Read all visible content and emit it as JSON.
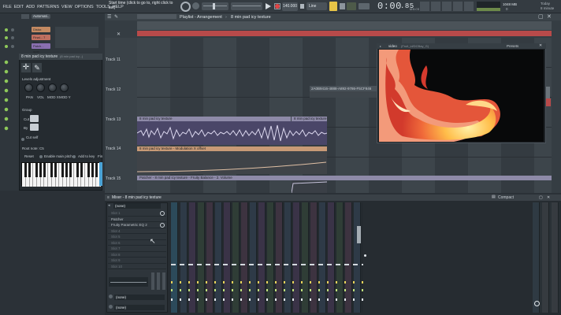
{
  "menu": [
    "FILE",
    "EDIT",
    "ADD",
    "PATTERNS",
    "VIEW",
    "OPTIONS",
    "TOOLS",
    "HELP"
  ],
  "hint": {
    "line1": "Start time (click to go to, right click to",
    "line2": "set)"
  },
  "transport": {
    "time": "0:00",
    "time_fraction": ".85",
    "time_label": "M:S:CS",
    "tempo": "140.000",
    "snap": "Line"
  },
  "cpu": {
    "value": "1048 MB",
    "sub": "0"
  },
  "topright": {
    "line1": "Today",
    "line2": "8 minute"
  },
  "channel_rack": {
    "title": "Automati..",
    "items": [
      "Distor. offset",
      "Final... 7 filter",
      "Patch... oper"
    ]
  },
  "plugin": {
    "title": "8 min pad icy texture",
    "title_sub": "(8 min pad icy...)",
    "levels_label": "Levels adjustment",
    "knobs": [
      "PAN",
      "VOL",
      "MOD X",
      "MOD Y"
    ],
    "group_label": "Group",
    "cut_label": "Cut",
    "by_label": "By",
    "cutself_label": "Cut self",
    "root_note": "Root note: C5",
    "reset": "Reset",
    "enable_main_pitch": "Enable main pitch",
    "add_to_key": "Add to key",
    "fine": "Fin"
  },
  "playlist": {
    "breadcrumb": "Playlist - Arrangement",
    "pattern": "8 min pad icy texture",
    "tracks": [
      "Track 11",
      "Track 12",
      "Track 13",
      "Track 14",
      "Track 15"
    ],
    "clips": {
      "track12_label": "2A0B9416-4888-A892-9786-F5CF846",
      "track13_a": "8 min pad icy texture",
      "track13_b": "8 min pad icy texture",
      "track14": "8 min pad icy texture - Modulation X offset",
      "patcher": "Patcher - 8 min pad icy texture - Fruity Balance - 2. Volume"
    }
  },
  "video": {
    "title": "video",
    "title_sub": "(Fruit_id/DCBay_G)",
    "presets": "Presets"
  },
  "mixer": {
    "title": "Mixer - 8 min pad icy texture",
    "preset": "(none)",
    "slots": [
      "Slot 1",
      "Patcher",
      "Fruity Parametric EQ 2",
      "Slot 4",
      "Slot 5",
      "Slot 6",
      "Slot 7",
      "Slot 8",
      "Slot 9",
      "Slot 10"
    ],
    "out1": "(none)",
    "out2": "(none)",
    "compact": "Compact"
  },
  "colors": {
    "accent": "#f0a04a",
    "clip_purple": "#8e8aa8",
    "clip_orange": "#c89a76",
    "red_bar": "#b84a4a"
  }
}
